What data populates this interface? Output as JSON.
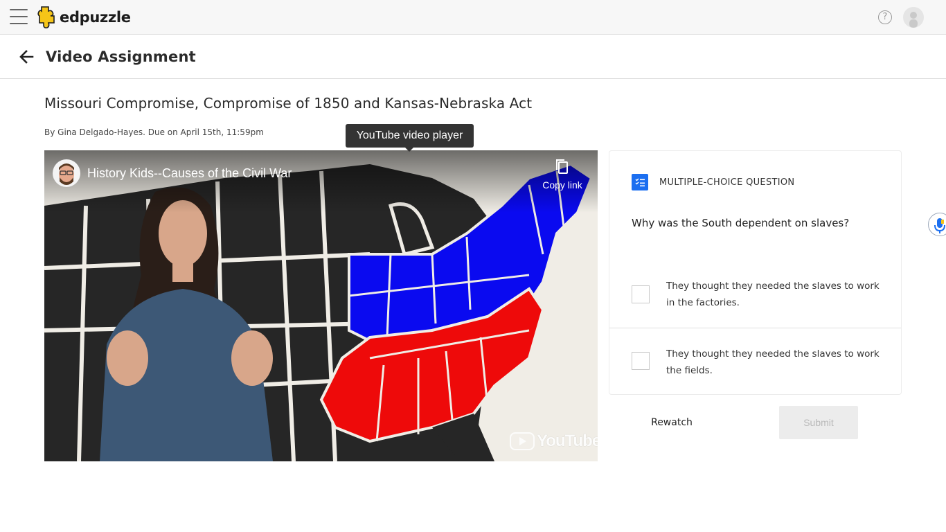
{
  "app": {
    "brand": "edpuzzle",
    "icons": {
      "menu": "hamburger-menu-icon",
      "help": "question-mark-icon",
      "avatar": "user-avatar-icon"
    },
    "brand_color": "#f5c518"
  },
  "subheader": {
    "title": "Video Assignment",
    "back_icon": "arrow-left-icon"
  },
  "assignment": {
    "title": "Missouri Compromise, Compromise of 1850 and Kansas-Nebraska Act",
    "meta": "By Gina Delgado-Hayes. Due on April 15th, 11:59pm"
  },
  "video": {
    "tooltip": "YouTube video player",
    "title": "History Kids--Causes of the Civil War",
    "copy_link_label": "Copy link",
    "youtube_label": "YouTube",
    "colors": {
      "union": "#0a0af0",
      "confederate": "#ee0a0a",
      "land": "#262626",
      "background": "#f0ede6"
    }
  },
  "question": {
    "type_label": "MULTIPLE-CHOICE QUESTION",
    "text": "Why was the South dependent on slaves?",
    "choices": [
      {
        "text": "They thought they needed the slaves to work in the factories.",
        "checked": false
      },
      {
        "text": "They thought they needed the slaves to work the fields.",
        "checked": false
      }
    ],
    "accent_color": "#1c6ff0"
  },
  "actions": {
    "rewatch_label": "Rewatch",
    "submit_label": "Submit",
    "submit_enabled": false
  }
}
